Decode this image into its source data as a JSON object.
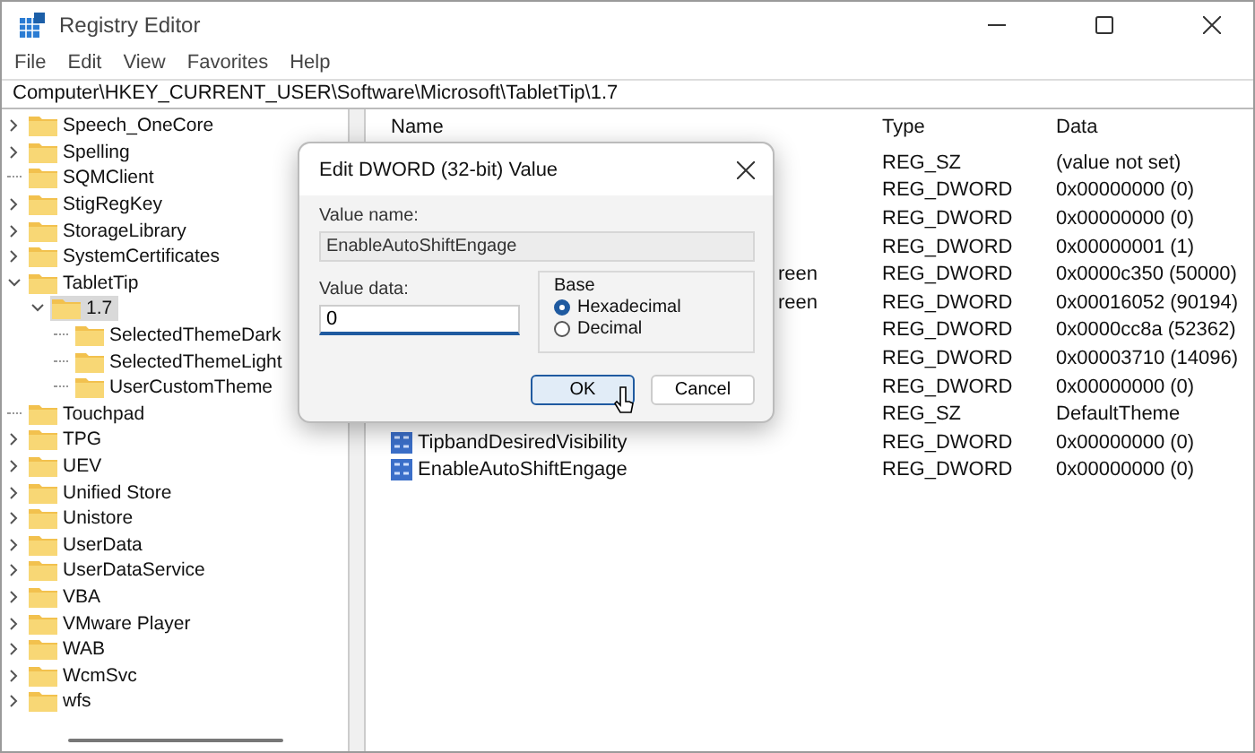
{
  "window": {
    "title": "Registry Editor"
  },
  "menu": [
    "File",
    "Edit",
    "View",
    "Favorites",
    "Help"
  ],
  "address": "Computer\\HKEY_CURRENT_USER\\Software\\Microsoft\\TabletTip\\1.7",
  "tree": [
    {
      "label": "Speech_OneCore",
      "kind": "collapsed",
      "selected": false
    },
    {
      "label": "Spelling",
      "kind": "collapsed",
      "selected": false
    },
    {
      "label": "SQMClient",
      "kind": "leaf",
      "selected": false
    },
    {
      "label": "StigRegKey",
      "kind": "collapsed",
      "selected": false
    },
    {
      "label": "StorageLibrary",
      "kind": "collapsed",
      "selected": false
    },
    {
      "label": "SystemCertificates",
      "kind": "collapsed",
      "selected": false
    },
    {
      "label": "TabletTip",
      "kind": "expanded",
      "selected": false,
      "children": [
        {
          "label": "1.7",
          "kind": "expanded",
          "selected": true,
          "children": [
            {
              "label": "SelectedThemeDark",
              "kind": "leaf",
              "selected": false
            },
            {
              "label": "SelectedThemeLight",
              "kind": "leaf",
              "selected": false
            },
            {
              "label": "UserCustomTheme",
              "kind": "leaf",
              "selected": false
            }
          ]
        }
      ]
    },
    {
      "label": "Touchpad",
      "kind": "leaf",
      "selected": false
    },
    {
      "label": "TPG",
      "kind": "collapsed",
      "selected": false
    },
    {
      "label": "UEV",
      "kind": "collapsed",
      "selected": false
    },
    {
      "label": "Unified Store",
      "kind": "collapsed",
      "selected": false
    },
    {
      "label": "Unistore",
      "kind": "collapsed",
      "selected": false
    },
    {
      "label": "UserData",
      "kind": "collapsed",
      "selected": false
    },
    {
      "label": "UserDataService",
      "kind": "collapsed",
      "selected": false
    },
    {
      "label": "VBA",
      "kind": "collapsed",
      "selected": false
    },
    {
      "label": "VMware Player",
      "kind": "collapsed",
      "selected": false
    },
    {
      "label": "WAB",
      "kind": "collapsed",
      "selected": false
    },
    {
      "label": "WcmSvc",
      "kind": "collapsed",
      "selected": false
    },
    {
      "label": "wfs",
      "kind": "collapsed",
      "selected": false
    }
  ],
  "table": {
    "columns": [
      "Name",
      "Type",
      "Data"
    ],
    "rows": [
      {
        "type": "REG_SZ",
        "data": "(value not set)"
      },
      {
        "type": "REG_DWORD",
        "data": "0x00000000 (0)"
      },
      {
        "type": "REG_DWORD",
        "data": "0x00000000 (0)"
      },
      {
        "type": "REG_DWORD",
        "data": "0x00000001 (1)"
      },
      {
        "name": "reen",
        "type": "REG_DWORD",
        "data": "0x0000c350 (50000)"
      },
      {
        "name": "reen",
        "type": "REG_DWORD",
        "data": "0x00016052 (90194)"
      },
      {
        "type": "REG_DWORD",
        "data": "0x0000cc8a (52362)"
      },
      {
        "type": "REG_DWORD",
        "data": "0x00003710 (14096)"
      },
      {
        "type": "REG_DWORD",
        "data": "0x00000000 (0)"
      },
      {
        "type": "REG_SZ",
        "data": "DefaultTheme"
      },
      {
        "name": "TipbandDesiredVisibility",
        "kind": "dword",
        "type": "REG_DWORD",
        "data": "0x00000000 (0)"
      },
      {
        "name": "EnableAutoShiftEngage",
        "kind": "dword",
        "type": "REG_DWORD",
        "data": "0x00000000 (0)"
      }
    ]
  },
  "dialog": {
    "title": "Edit DWORD (32-bit) Value",
    "name_label": "Value name:",
    "name_value": "EnableAutoShiftEngage",
    "data_label": "Value data:",
    "data_value": "0",
    "base_label": "Base",
    "base_options": [
      {
        "label": "Hexadecimal",
        "selected": true
      },
      {
        "label": "Decimal",
        "selected": false
      }
    ],
    "buttons": [
      {
        "label": "OK",
        "default": true
      },
      {
        "label": "Cancel",
        "default": false
      }
    ]
  }
}
